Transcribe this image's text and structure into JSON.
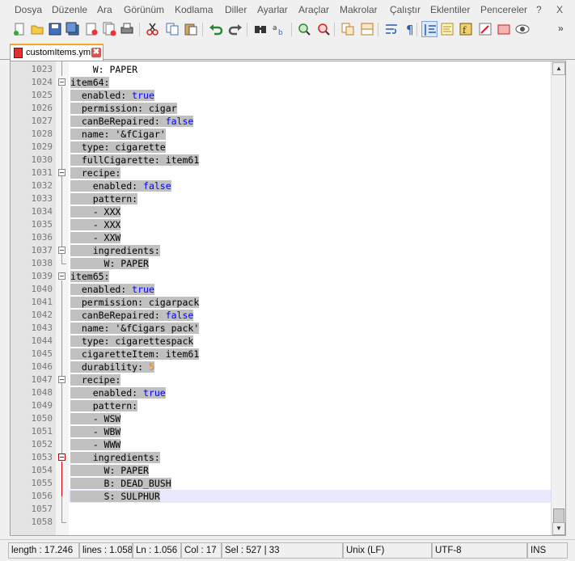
{
  "menu": [
    "Dosya",
    "Düzenle",
    "Ara",
    "Görünüm",
    "Kodlama",
    "Diller",
    "Ayarlar",
    "Araçlar",
    "Makrolar",
    "Çalıştır",
    "Eklentiler",
    "Pencereler",
    "?",
    "X"
  ],
  "toolbar_icons": [
    "new-file-icon",
    "open-file-icon",
    "save-icon",
    "save-all-icon",
    "close-icon",
    "close-all-icon",
    "print-icon",
    "cut-icon",
    "copy-icon",
    "paste-icon",
    "undo-icon",
    "redo-icon",
    "find-icon",
    "replace-icon",
    "zoom-in-icon",
    "zoom-out-icon",
    "sync-v-icon",
    "sync-h-icon",
    "word-wrap-icon",
    "show-all-chars-icon",
    "indent-guide-icon",
    "doc-map-icon",
    "function-list-icon",
    "macro-record-icon",
    "macro-stop-icon",
    "monitor-icon"
  ],
  "tab": {
    "label": "customItems.yml",
    "close": "✖"
  },
  "editor": {
    "lines": [
      {
        "n": "1023",
        "text": "    W: PAPER",
        "sel": false
      },
      {
        "n": "1024",
        "text": "item64:",
        "sel": true
      },
      {
        "n": "1025",
        "key": "  enabled: ",
        "val": "true",
        "vtype": "kw",
        "sel": true
      },
      {
        "n": "1026",
        "text": "  permission: cigar",
        "sel": true
      },
      {
        "n": "1027",
        "key": "  canBeRepaired: ",
        "val": "false",
        "vtype": "kw",
        "sel": true
      },
      {
        "n": "1028",
        "text": "  name: '&fCigar'",
        "sel": true
      },
      {
        "n": "1029",
        "text": "  type: cigarette",
        "sel": true
      },
      {
        "n": "1030",
        "text": "  fullCigarette: item61",
        "sel": true
      },
      {
        "n": "1031",
        "text": "  recipe:",
        "sel": true
      },
      {
        "n": "1032",
        "key": "    enabled: ",
        "val": "false",
        "vtype": "kw",
        "sel": true
      },
      {
        "n": "1033",
        "text": "    pattern:",
        "sel": true
      },
      {
        "n": "1034",
        "text": "    - XXX",
        "sel": true
      },
      {
        "n": "1035",
        "text": "    - XXX",
        "sel": true
      },
      {
        "n": "1036",
        "text": "    - XXW",
        "sel": true
      },
      {
        "n": "1037",
        "text": "    ingredients:",
        "sel": true
      },
      {
        "n": "1038",
        "text": "      W: PAPER",
        "sel": true
      },
      {
        "n": "1039",
        "text": "item65:",
        "sel": true
      },
      {
        "n": "1040",
        "key": "  enabled: ",
        "val": "true",
        "vtype": "kw",
        "sel": true
      },
      {
        "n": "1041",
        "text": "  permission: cigarpack",
        "sel": true
      },
      {
        "n": "1042",
        "key": "  canBeRepaired: ",
        "val": "false",
        "vtype": "kw",
        "sel": true
      },
      {
        "n": "1043",
        "text": "  name: '&fCigars pack'",
        "sel": true
      },
      {
        "n": "1044",
        "text": "  type: cigarettespack",
        "sel": true
      },
      {
        "n": "1045",
        "text": "  cigaretteItem: item61",
        "sel": true
      },
      {
        "n": "1046",
        "key": "  durability: ",
        "val": "5",
        "vtype": "num",
        "sel": true
      },
      {
        "n": "1047",
        "text": "  recipe:",
        "sel": true
      },
      {
        "n": "1048",
        "key": "    enabled: ",
        "val": "true",
        "vtype": "kw",
        "sel": true
      },
      {
        "n": "1049",
        "text": "    pattern:",
        "sel": true
      },
      {
        "n": "1050",
        "text": "    - WSW",
        "sel": true
      },
      {
        "n": "1051",
        "text": "    - WBW",
        "sel": true
      },
      {
        "n": "1052",
        "text": "    - WWW",
        "sel": true
      },
      {
        "n": "1053",
        "text": "    ingredients:",
        "sel": true
      },
      {
        "n": "1054",
        "text": "      W: PAPER",
        "sel": true
      },
      {
        "n": "1055",
        "text": "      B: DEAD_BUSH",
        "sel": true
      },
      {
        "n": "1056",
        "text": "      S: SULPHUR",
        "sel": true,
        "current": true
      },
      {
        "n": "1057",
        "text": "",
        "sel": false
      },
      {
        "n": "1058",
        "text": "",
        "sel": false
      }
    ]
  },
  "status": {
    "length": "length : 17.246",
    "lines": "lines : 1.058",
    "ln": "Ln : 1.056",
    "col": "Col : 17",
    "sel": "Sel : 527 | 33",
    "eol": "Unix (LF)",
    "encoding": "UTF-8",
    "mode": "INS"
  },
  "colors": {
    "keyword": "#0000ff",
    "number": "#ff8000",
    "selection": "#c0c0c0",
    "tab_accent": "#f5a623"
  }
}
